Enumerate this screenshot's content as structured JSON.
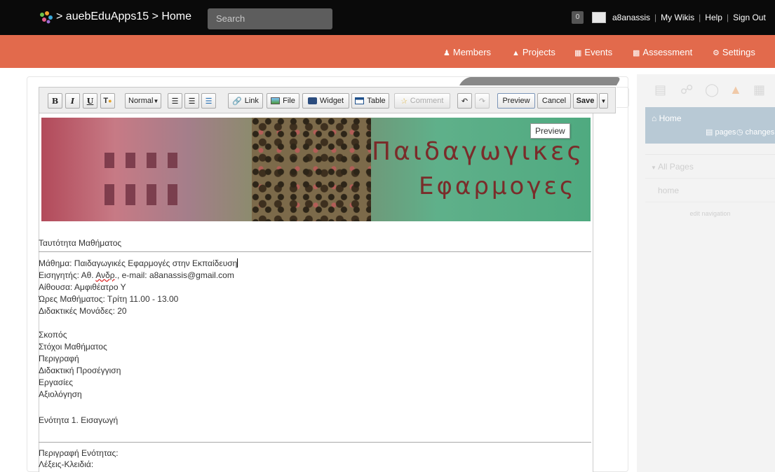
{
  "header": {
    "breadcrumb": "> auebEduApps15 > Home",
    "search_placeholder": "Search",
    "notification_count": "0",
    "user": {
      "username": "a8anassis",
      "my_wikis": "My Wikis",
      "help": "Help",
      "sign_out": "Sign Out"
    }
  },
  "nav": {
    "members": "Members",
    "projects": "Projects",
    "events": "Events",
    "assessment": "Assessment",
    "settings": "Settings"
  },
  "toolbar": {
    "bold": "B",
    "italic": "I",
    "underline": "U",
    "format": "Normal",
    "link": "Link",
    "file": "File",
    "widget": "Widget",
    "table": "Table",
    "comment": "Comment",
    "preview": "Preview",
    "cancel": "Cancel",
    "save": "Save"
  },
  "editor": {
    "tooltip": "Preview",
    "banner_title_line1": "Παιδαγωγικες",
    "banner_title_line2": "Εφαρμογες",
    "course_identity": "Ταυτότητα Μαθήματος",
    "course_line": "Μάθημα: Παιδαγωγικές Εφαρμογές στην Εκπαίδευση",
    "instructor_prefix": "Εισηγητής: Αθ. ",
    "instructor_name": "Ανδρ",
    "instructor_suffix": "., e-mail: a8anassis@gmail.com",
    "room": "Αίθουσα: Αμφιθέατρο Υ",
    "hours": "Ώρες Μαθήματος: Τρίτη 11.00 - 13.00",
    "credits": "Διδακτικές Μονάδες: 20",
    "sections": [
      "Σκοπός",
      "Στόχοι Μαθήματος",
      "Περιγραφή",
      "Διδακτική Προσέγγιση",
      "Εργασίες",
      "Αξιολόγηση"
    ],
    "unit1": "Ενότητα 1. Εισαγωγή",
    "unit_description": "Περιγραφή Ενότητας:",
    "keywords": "Λέξεις-Κλειδιά:"
  },
  "sidebar": {
    "home": "Home",
    "pages": "pages",
    "changes": "changes",
    "all_pages": "All Pages",
    "page_home": "home",
    "edit_navigation": "edit navigation"
  }
}
